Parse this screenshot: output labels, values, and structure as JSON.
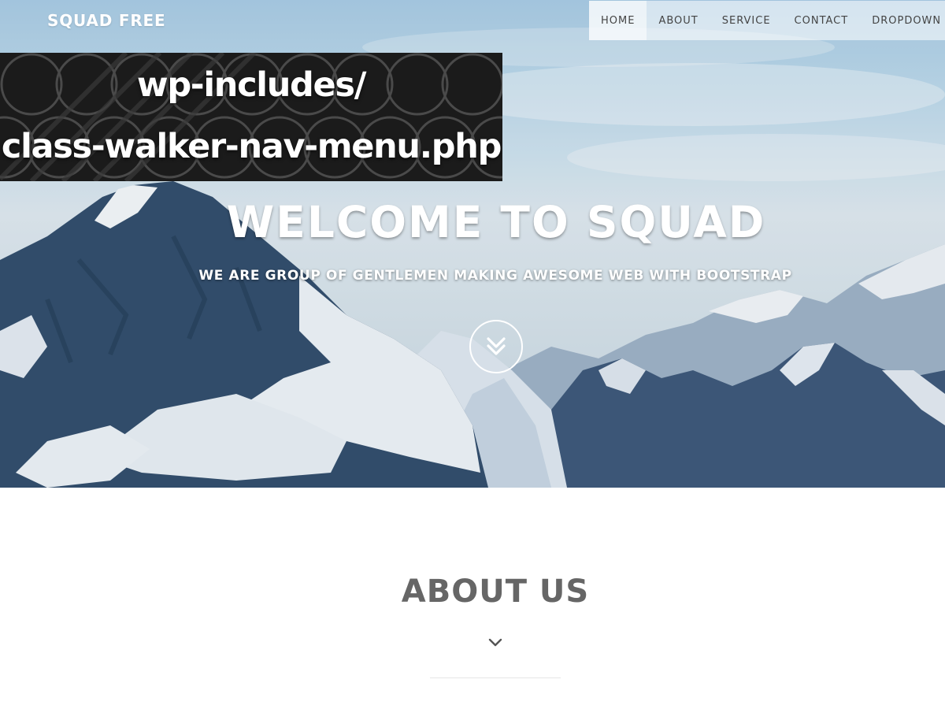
{
  "navbar": {
    "brand": "SQUAD FREE",
    "items": [
      {
        "label": "HOME",
        "active": true
      },
      {
        "label": "ABOUT",
        "active": false
      },
      {
        "label": "SERVICE",
        "active": false
      },
      {
        "label": "CONTACT",
        "active": false
      },
      {
        "label": "DROPDOWN",
        "active": false,
        "has_caret": true
      }
    ]
  },
  "banner": {
    "line1": "wp-includes/",
    "line2": "class-walker-nav-menu.php"
  },
  "hero": {
    "title": "WELCOME TO SQUAD",
    "subtitle": "WE ARE GROUP OF GENTLEMEN MAKING AWESOME WEB WITH BOOTSTRAP",
    "scroll_icon": "double-chevron-down-icon"
  },
  "about": {
    "title": "ABOUT US",
    "icon": "chevron-down-icon"
  },
  "colors": {
    "nav_text": "#444444",
    "about_title": "#666666",
    "hero_text": "#ffffff",
    "banner_bg": "#1b1b1b"
  }
}
